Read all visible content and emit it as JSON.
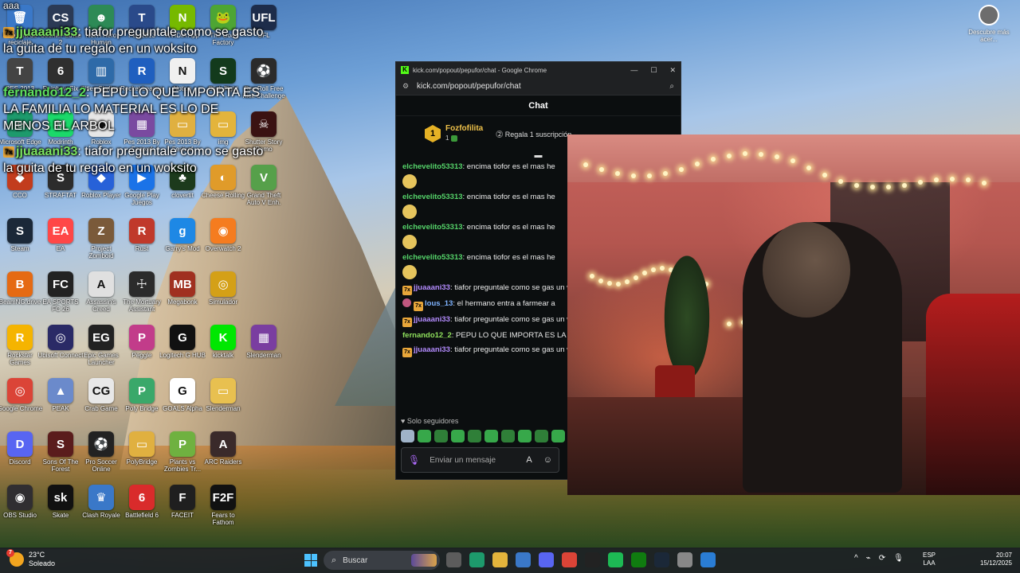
{
  "desktop": {
    "icons": [
      {
        "label": "Papelera de reciclaje",
        "color": "#3a78c8",
        "glyph": "🗑"
      },
      {
        "label": "Counter-Strike 2",
        "color": "#2b3a55",
        "glyph": "CS"
      },
      {
        "label": "Not A Hero Human",
        "color": "#2d8a56",
        "glyph": "☻"
      },
      {
        "label": "Pes 2013",
        "color": "#2a4a8a",
        "glyph": "T"
      },
      {
        "label": "NVIDIA App",
        "color": "#76b900",
        "glyph": "N"
      },
      {
        "label": "The Goat Factory",
        "color": "#4da534",
        "glyph": "🐸"
      },
      {
        "label": "UFL",
        "color": "#1d2c4a",
        "glyph": "UFL"
      },
      {
        "label": "PES 2013",
        "color": "#444",
        "glyph": "T"
      },
      {
        "label": "Rainbow Six",
        "color": "#2f2f2f",
        "glyph": "6"
      },
      {
        "label": "Cities Skylines",
        "color": "#2e6aa8",
        "glyph": "▥"
      },
      {
        "label": "Rocket League",
        "color": "#1f5fbf",
        "glyph": "R"
      },
      {
        "label": "Notion",
        "color": "#f0f0f0",
        "glyph": "N"
      },
      {
        "label": "Stick Fight",
        "color": "#133a1c",
        "glyph": "S"
      },
      {
        "label": "Rev Roll Free Kick Challenge",
        "color": "#2b2b2b",
        "glyph": "⚽"
      },
      {
        "label": "Microsoft Edge",
        "color": "#1d9a6c",
        "glyph": "e"
      },
      {
        "label": "Modrinth",
        "color": "#1bd96a",
        "glyph": "M"
      },
      {
        "label": "Roblox",
        "color": "#e6e6e6",
        "glyph": "◆"
      },
      {
        "label": "Pes 2013 By Fenixaf",
        "color": "#7a4aa0",
        "glyph": "▦"
      },
      {
        "label": "Pes 2013 By Fenixaf",
        "color": "#e0b040",
        "glyph": "▭"
      },
      {
        "label": "img",
        "color": "#e3b43c",
        "glyph": "▭"
      },
      {
        "label": "Shutter Story Demo",
        "color": "#3a1212",
        "glyph": "☠"
      },
      {
        "label": "CCO",
        "color": "#c23c1d",
        "glyph": "◆"
      },
      {
        "label": "STRAFTAT",
        "color": "#2c2c2c",
        "glyph": "S"
      },
      {
        "label": "Roblox Player",
        "color": "#2761d8",
        "glyph": "◆"
      },
      {
        "label": "Google Play Juegos",
        "color": "#1a73e8",
        "glyph": "▶"
      },
      {
        "label": "clovertit",
        "color": "#1c3a1c",
        "glyph": "♣"
      },
      {
        "label": "Cheese Rolling",
        "color": "#e09b2a",
        "glyph": "◐"
      },
      {
        "label": "Grand Theft Auto V Enh.",
        "color": "#56a04a",
        "glyph": "V"
      },
      {
        "label": "Steam",
        "color": "#1b2838",
        "glyph": "S"
      },
      {
        "label": "EA",
        "color": "#ff4747",
        "glyph": "EA"
      },
      {
        "label": "Project Zomboid",
        "color": "#7a5a3a",
        "glyph": "Z"
      },
      {
        "label": "Rust",
        "color": "#c0392b",
        "glyph": "R"
      },
      {
        "label": "Garry's Mod",
        "color": "#1e88e5",
        "glyph": "g"
      },
      {
        "label": "Overwatch 2",
        "color": "#f57c1f",
        "glyph": "◉"
      },
      {
        "label": "BeamNG.drive",
        "color": "#e56a13",
        "glyph": "B"
      },
      {
        "label": "EA SPORTS FC 26",
        "color": "#222",
        "glyph": "FC"
      },
      {
        "label": "Assassin's Creed",
        "color": "#e0e0e0",
        "glyph": "A"
      },
      {
        "label": "The Mortuary Assistant",
        "color": "#2b2b2b",
        "glyph": "☩"
      },
      {
        "label": "Megabonk",
        "color": "#a03020",
        "glyph": "MB"
      },
      {
        "label": "Simulador",
        "color": "#d4a017",
        "glyph": "◎"
      },
      {
        "label": "Rockstar Games",
        "color": "#f5b400",
        "glyph": "R"
      },
      {
        "label": "Ubisoft Connect",
        "color": "#2a2a66",
        "glyph": "◎"
      },
      {
        "label": "Epic Games Launcher",
        "color": "#222",
        "glyph": "EG"
      },
      {
        "label": "Peggle",
        "color": "#c23c8a",
        "glyph": "P"
      },
      {
        "label": "Logitech G HUB",
        "color": "#111",
        "glyph": "G"
      },
      {
        "label": "kicktalk",
        "color": "#00e701",
        "glyph": "K"
      },
      {
        "label": "Slenderman",
        "color": "#7a3ea0",
        "glyph": "▦"
      },
      {
        "label": "Google Chrome",
        "color": "#db4437",
        "glyph": "◎"
      },
      {
        "label": "PEAK",
        "color": "#6b8acb",
        "glyph": "▲"
      },
      {
        "label": "Crab Game",
        "color": "#e8e8e8",
        "glyph": "CG"
      },
      {
        "label": "Poly Bridge",
        "color": "#3aa86a",
        "glyph": "P"
      },
      {
        "label": "GOALS Alpha",
        "color": "#fff",
        "glyph": "G"
      },
      {
        "label": "Slenderman",
        "color": "#e8c050",
        "glyph": "▭"
      },
      {
        "label": "Discord",
        "color": "#5865f2",
        "glyph": "D"
      },
      {
        "label": "Sons Of The Forest",
        "color": "#5a1c1c",
        "glyph": "S"
      },
      {
        "label": "Pro Soccer Online",
        "color": "#222",
        "glyph": "⚽"
      },
      {
        "label": "PolyBridge",
        "color": "#e0b040",
        "glyph": "▭"
      },
      {
        "label": "Plants vs Zombies Tr...",
        "color": "#6fb140",
        "glyph": "P"
      },
      {
        "label": "ARC Raiders",
        "color": "#3a2a2a",
        "glyph": "A"
      },
      {
        "label": "OBS Studio",
        "color": "#302e31",
        "glyph": "◉"
      },
      {
        "label": "Skate",
        "color": "#111",
        "glyph": "sk"
      },
      {
        "label": "Clash Royale",
        "color": "#3a78c8",
        "glyph": "♛"
      },
      {
        "label": "Battlefield 6",
        "color": "#d92b2b",
        "glyph": "6"
      },
      {
        "label": "FACEIT",
        "color": "#1f1f1f",
        "glyph": "F"
      },
      {
        "label": "Fears to Fathom",
        "color": "#111",
        "glyph": "F2F"
      }
    ],
    "corner_app": {
      "label": "Descubre más acer..."
    }
  },
  "overlay": {
    "lines": [
      {
        "user": "jjuaaani33",
        "text": " tiafor preguntale como se gasto la guita de tu regalo en un woksito",
        "badge": "7x"
      },
      {
        "user": "fernando12_2",
        "text": " PEPU LO QUE IMPORTA ES LA FAMILIA LO MATERIAL ES LO DE MENOS EL ARBOL",
        "badge": ""
      },
      {
        "user": "jjuaaani33",
        "text": " tiafor preguntale como se gasto la guita de tu regalo en un woksito",
        "badge": "7x"
      }
    ],
    "top_fragment": "aaa"
  },
  "browser": {
    "window_title": "kick.com/popout/pepufor/chat - Google Chrome",
    "url": "kick.com/popout/pepufor/chat",
    "controls": {
      "minimize": "—",
      "maximize": "☐",
      "close": "✕"
    }
  },
  "chat": {
    "header": "Chat",
    "pinned": {
      "rank": "1",
      "name": "Fozfofilita",
      "sub": "1",
      "gift_text": "Regala 1 suscripción"
    },
    "messages": [
      {
        "user": "elchevelito53313",
        "text": " encima tiofor es el mas he",
        "emote": true,
        "color": "green"
      },
      {
        "user": "elchevelito53313",
        "text": " encima tiofor es el mas he",
        "emote": true,
        "color": "green"
      },
      {
        "user": "elchevelito53313",
        "text": " encima tiofor es el mas he",
        "emote": true,
        "color": "green"
      },
      {
        "user": "elchevelito53313",
        "text": " encima tiofor es el mas he",
        "emote": true,
        "color": "green"
      },
      {
        "user": "jjuaaani33",
        "text": " tiafor preguntale como se gas un woksito",
        "emote": false,
        "color": "purple"
      },
      {
        "user": "lous_13",
        "text": " el hermano entra a farmear a",
        "emote": false,
        "color": "blue"
      },
      {
        "user": "jjuaaani33",
        "text": " tiafor preguntale como se gas un woksito",
        "emote": false,
        "color": "purple"
      },
      {
        "user": "fernando12_2",
        "text": " PEPU LO QUE IMPORTA ES LA LO DE MENOS EL ARBOL",
        "emote": false,
        "color": "lime"
      },
      {
        "user": "jjuaaani33",
        "text": " tiafor preguntale como se gas un woksito",
        "emote": false,
        "color": "purple"
      }
    ],
    "followers_only": "Solo seguidores",
    "input_placeholder": "Enviar un mensaje"
  },
  "taskbar": {
    "weather_temp": "23°C",
    "weather_desc": "Soleado",
    "weather_badge": "7",
    "search_placeholder": "Buscar",
    "lang_top": "ESP",
    "lang_bottom": "LAA",
    "time": "20:07",
    "date": "15/12/2025"
  },
  "colors": {
    "kick_green": "#53fc18",
    "username_green": "#55d46a",
    "username_purple": "#b48cff"
  }
}
